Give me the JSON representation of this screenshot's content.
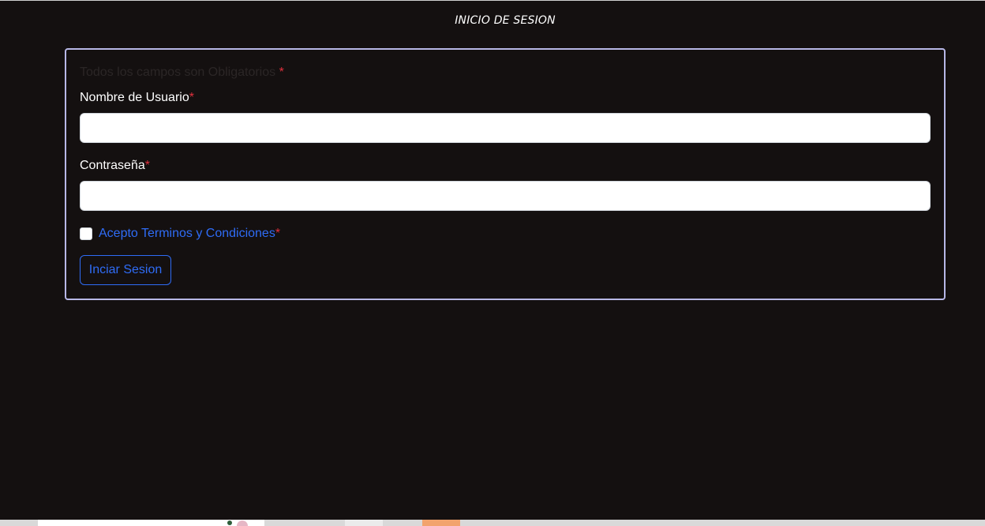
{
  "page": {
    "title": "INICIO DE SESION"
  },
  "form": {
    "required_note": "Todos los campos son Obligatorios",
    "required_marker": "*",
    "username": {
      "label": "Nombre de Usuario",
      "value": "",
      "placeholder": ""
    },
    "password": {
      "label": "Contraseña",
      "value": "",
      "placeholder": ""
    },
    "terms": {
      "label": "Acepto Terminos y Condiciones",
      "checked": false
    },
    "submit_label": "Inciar Sesion"
  },
  "colors": {
    "background": "#141010",
    "card_border": "#b7b7e6",
    "accent": "#2f6cf6",
    "required": "#e0303d"
  }
}
